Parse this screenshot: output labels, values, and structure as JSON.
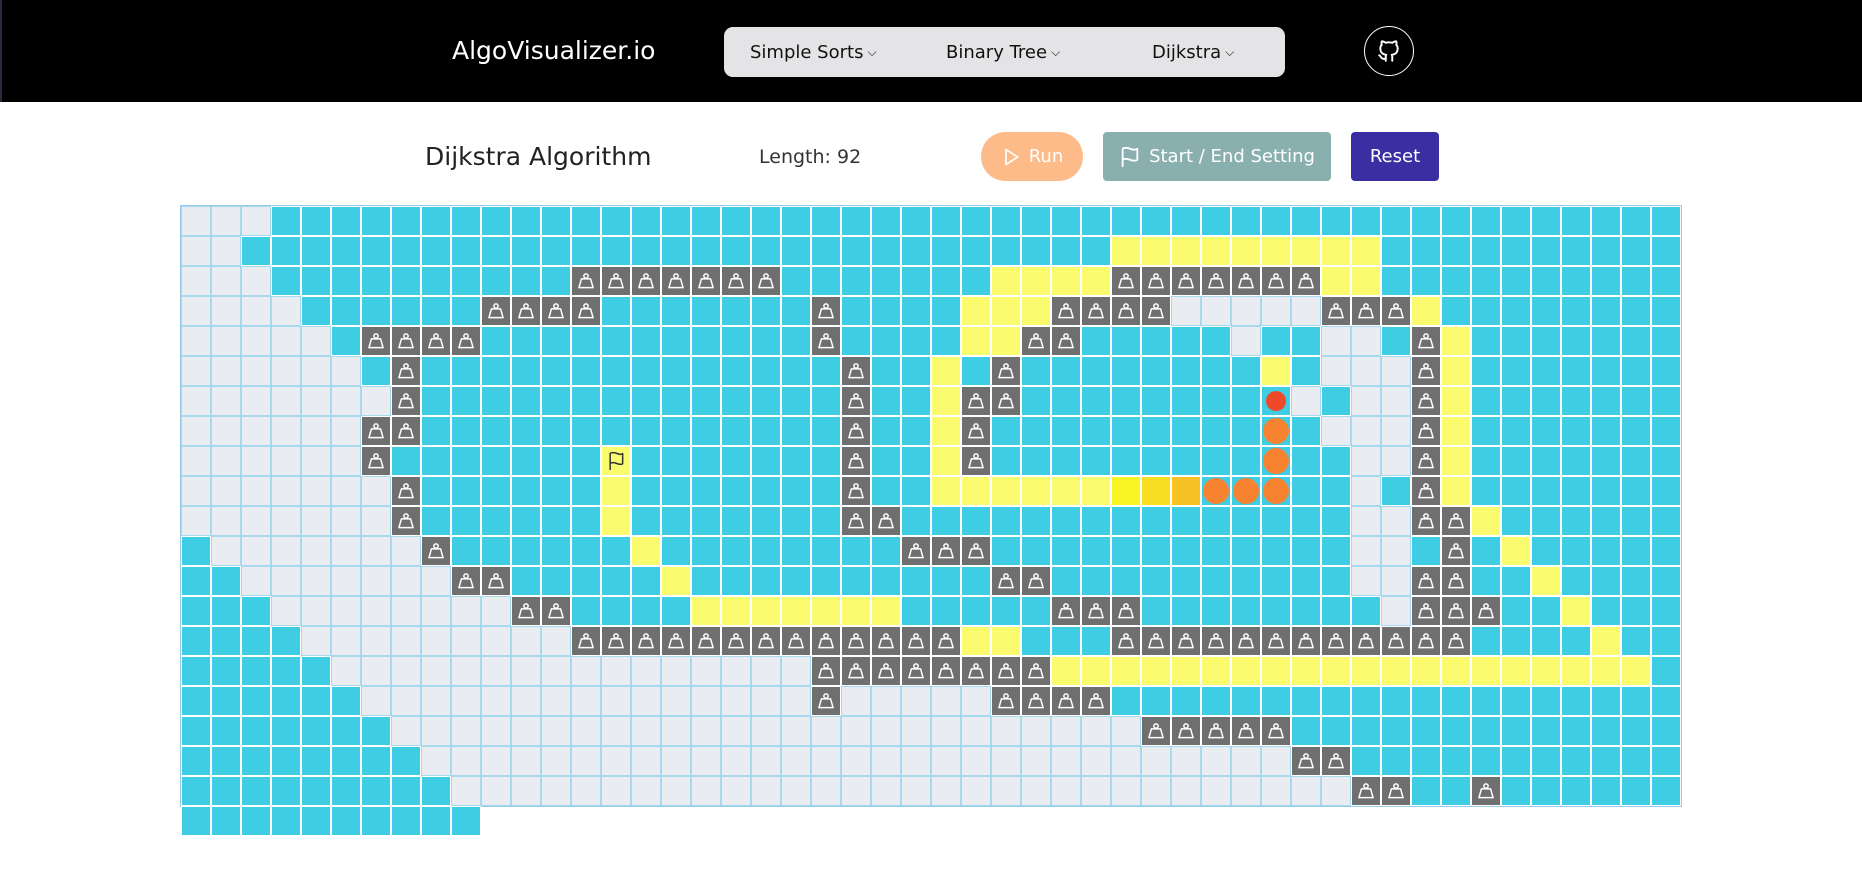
{
  "nav": {
    "brand": "AlgoVisualizer.io",
    "menu": [
      {
        "label": "Simple Sorts"
      },
      {
        "label": "Binary Tree"
      },
      {
        "label": "Dijkstra"
      }
    ],
    "github_icon": "github-icon"
  },
  "toolbar": {
    "title": "Dijkstra Algorithm",
    "length_label": "Length:",
    "length_value": "92",
    "run_label": "Run",
    "start_end_label": "Start / End Setting",
    "reset_label": "Reset"
  },
  "grid": {
    "cols": 50,
    "rows": 20,
    "legend": {
      "u": "unvisited",
      "v": "visited",
      "w": "weight",
      "p": "path",
      "s": "start",
      "e": "end"
    },
    "colors": {
      "unvisited": "#e9ecf1",
      "visited": "#3ecde2",
      "weight": "#6f6f6f",
      "path": "#fbfb70",
      "path_gradient": [
        "#f8f426",
        "#f7de22",
        "#f6c224",
        "#f4a42a",
        "#f28c32"
      ],
      "end_marker": "#f7822f",
      "end_marker_head": "#ee4a2a"
    },
    "cells": [
      "uuuvvvvvvvvvvvvvvvvvvvvvvvvvvvvvvvvvvvvvvvvvvvvvvv",
      "uuvvvvvvvvvvvvvvvvvvvvvvvvvvvvvpppppppppvvvvvvvvvv",
      "uuuvvvvvvvvvvwwwwwwwvvvvvvvppppwwwwwwwppvvvvvvvvvv",
      "uuuuvvvvvvwwwwvvvvvvvwvvvvpppwwwwuuuuuwwwpvvvvvvvv",
      "uuuuuvwwwwvvvvvvvvvvvwvvvvppwwvvvvvuvvuuvwpvvvvvvv",
      "uuuuuuvwvvvvvvvvvvvvvvwvvpvwvvvvvvvvpvuuuwpvvvvvvv",
      "uuuuuuuwvvvvvvvvvvvvvvwvvpwwvvvvvvvvpuvuuwpvvvvvvv",
      "uuuuuuwwvvvvvvvvvvvvvvwvvpwvvvvvvvvvpvuuuwpvvvvvvv",
      "uuuuuuwvvvvvvvsvvvvvvvwvvpwvvvvvvvvvpvvuuwpvvvvvvv",
      "uuuuuuuwvvvvvvpvvvvvvvwvvpppppppppppevvuvwpvvvvvvv",
      "uuuuuuuwvvvvvvpvvvvvvvwwvvvvvvvvvvvvvvvuuwwpvvvvvvv",
      "uuuuuuuwvvvvvvpvvvvvvvvwwwvvvvvvvvvvvvuuvwvpvvvvvvv",
      "uuuuuuuwwvvvvvpvvvvvvvvvvwwvvvvvvvvvvuuwwvvpvvvvvvv",
      "uuuuuuuuwwvvvvpppppppvvvvvwwwvvvvvvvvuwwwvvpvvvvvvv",
      "uuuuuuuuuwwwwwwwwwwwwwppvvvwwwwwwwwwwwwvvvvpvvvvvvv",
      "uuuuuuuuuuuuuuuuwwwwwwwwppppppppppppppppppppvvvvvvv",
      "uuuuuuuuuuuuuuuwuuuuuwwwwvvvvvvvvvvvvvvvvvvvvvvvvvv",
      "uuuuuuuuuuuuuuuuuuuuuuuuuwwwwwvvvvvvvvvvvvvvvvvvvvv",
      "uuuuuuuuuuuuuuuuuuuuuuuuuuuuuwwvvvvvvvvvvvvvvvvvvvv",
      "uuuuuuuuuuuuuuuuuuuuuuuuuuuuuuwwvvwvvvvvvvvvvvvvvvv"
    ]
  }
}
